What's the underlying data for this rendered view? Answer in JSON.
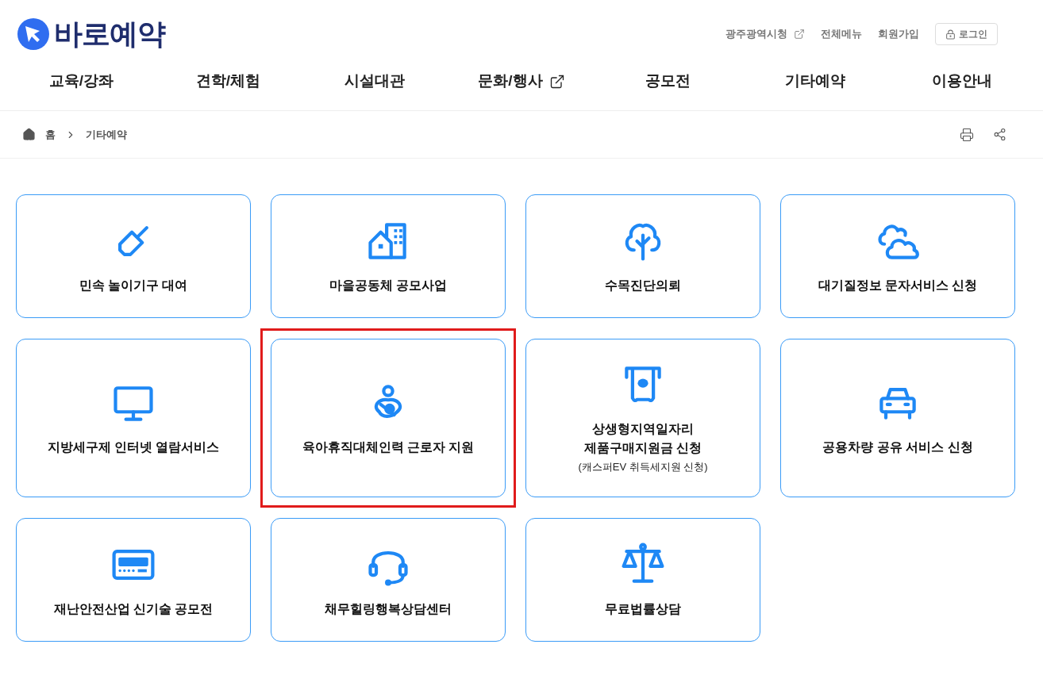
{
  "header": {
    "logo": "바로예약",
    "utility_links": [
      {
        "label": "광주광역시청",
        "external": true
      },
      {
        "label": "전체메뉴",
        "external": false
      },
      {
        "label": "회원가입",
        "external": false
      }
    ],
    "login_button": "로그인"
  },
  "nav": [
    {
      "label": "교육/강좌",
      "external": false
    },
    {
      "label": "견학/체험",
      "external": false
    },
    {
      "label": "시설대관",
      "external": false
    },
    {
      "label": "문화/행사",
      "external": true
    },
    {
      "label": "공모전",
      "external": false
    },
    {
      "label": "기타예약",
      "external": false
    },
    {
      "label": "이용안내",
      "external": false
    }
  ],
  "breadcrumb": {
    "home": "홈",
    "current": "기타예약"
  },
  "cards": [
    {
      "title": "민속 놀이기구 대여",
      "highlighted": false
    },
    {
      "title": "마을공동체 공모사업",
      "highlighted": false
    },
    {
      "title": "수목진단의뢰",
      "highlighted": false
    },
    {
      "title": "대기질정보 문자서비스 신청",
      "highlighted": false
    },
    {
      "title": "지방세구제 인터넷 열람서비스",
      "highlighted": false
    },
    {
      "title": "육아휴직대체인력 근로자 지원",
      "highlighted": true
    },
    {
      "title": "상생형지역일자리\n제품구매지원금 신청",
      "subtitle": "(캐스퍼EV 취득세지원 신청)",
      "highlighted": false
    },
    {
      "title": "공용차량 공유 서비스 신청",
      "highlighted": false
    },
    {
      "title": "재난안전산업 신기술 공모전",
      "highlighted": false
    },
    {
      "title": "채무힐링행복상담센터",
      "highlighted": false
    },
    {
      "title": "무료법률상담",
      "highlighted": false
    }
  ]
}
